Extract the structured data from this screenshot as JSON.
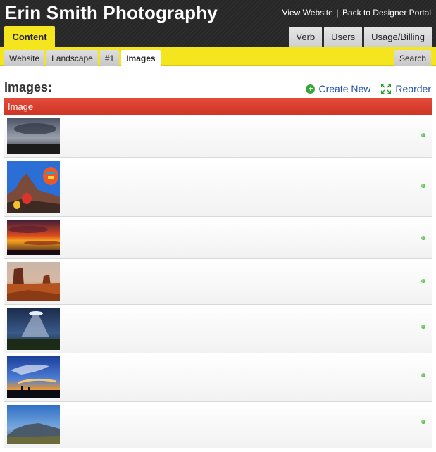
{
  "header": {
    "site_title": "Erin Smith Photography",
    "links": [
      "View Website",
      "Back to Designer Portal"
    ],
    "active_tab": "Content",
    "right_tabs": [
      "Verb",
      "Users",
      "Usage/Billing"
    ]
  },
  "subnav": {
    "breadcrumbs": [
      "Website",
      "Landscape",
      "#1",
      "Images"
    ],
    "search_label": "Search"
  },
  "main": {
    "heading": "Images:",
    "create_new_label": "Create New",
    "reorder_label": "Reorder",
    "column_header": "Image",
    "rows": [
      {
        "image": "cloudy-dark-sky"
      },
      {
        "image": "hot-air-balloons-rock-formation"
      },
      {
        "image": "orange-sunset-clouds"
      },
      {
        "image": "red-rock-buttes"
      },
      {
        "image": "sunbeams-through-clouds"
      },
      {
        "image": "blue-sky-sunset-silhouette"
      },
      {
        "image": "mountain-blue-sky"
      }
    ]
  },
  "colors": {
    "accent_yellow": "#f4e51f",
    "header_dark": "#2a2a2a",
    "table_header_red": "#d93b2b",
    "link_blue": "#1d4fa8",
    "status_green": "#3aa53a"
  }
}
